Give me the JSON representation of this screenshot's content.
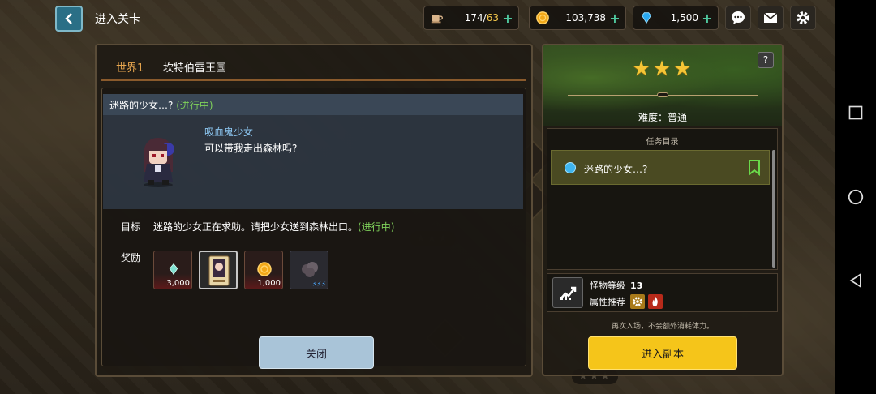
{
  "header": {
    "title": "进入关卡",
    "resources": [
      {
        "name": "stamina",
        "icon": "coffee-cup-icon",
        "current": "174",
        "separator": "/",
        "max": "63"
      },
      {
        "name": "gold",
        "icon": "gold-coin-icon",
        "value": "103,738"
      },
      {
        "name": "gem",
        "icon": "blue-gem-icon",
        "value": "1,500"
      }
    ],
    "plus_symbol": "+"
  },
  "left_panel": {
    "world_tab": "世界1",
    "world_name": "坎特伯雷王国",
    "quest_title": "迷路的少女…?",
    "quest_status": "(进行中)",
    "npc_name": "吸血鬼少女",
    "npc_line": "可以带我走出森林吗?",
    "goal_label": "目标",
    "goal_text": "迷路的少女正在求助。请把少女送到森林出口。",
    "goal_status": "(进行中)",
    "reward_label": "奖励",
    "rewards": [
      {
        "icon": "crystal-icon",
        "qty": "3,000"
      },
      {
        "icon": "hero-card-icon",
        "qty": ""
      },
      {
        "icon": "gold-coin-icon",
        "qty": "1,000"
      },
      {
        "icon": "hidden-reward-icon",
        "qty": "⚡⚡⚡"
      }
    ],
    "close_label": "关闭"
  },
  "right_panel": {
    "help": "?",
    "stars": [
      "★",
      "★",
      "★"
    ],
    "difficulty_label": "难度",
    "difficulty_sep": "：",
    "difficulty_value": "普通",
    "mission_header": "任务目录",
    "mission_item": "迷路的少女…?",
    "monster_level_label": "怪物等级",
    "monster_level": "13",
    "attribute_label": "属性推荐",
    "hint": "再次入场，不会额外消耗体力。",
    "enter_label": "进入副本"
  },
  "colors": {
    "accent_yellow": "#f5c51a",
    "progress_green": "#7fd15a",
    "npc_blue": "#8bc4ee",
    "world_orange": "#e6a54e"
  }
}
